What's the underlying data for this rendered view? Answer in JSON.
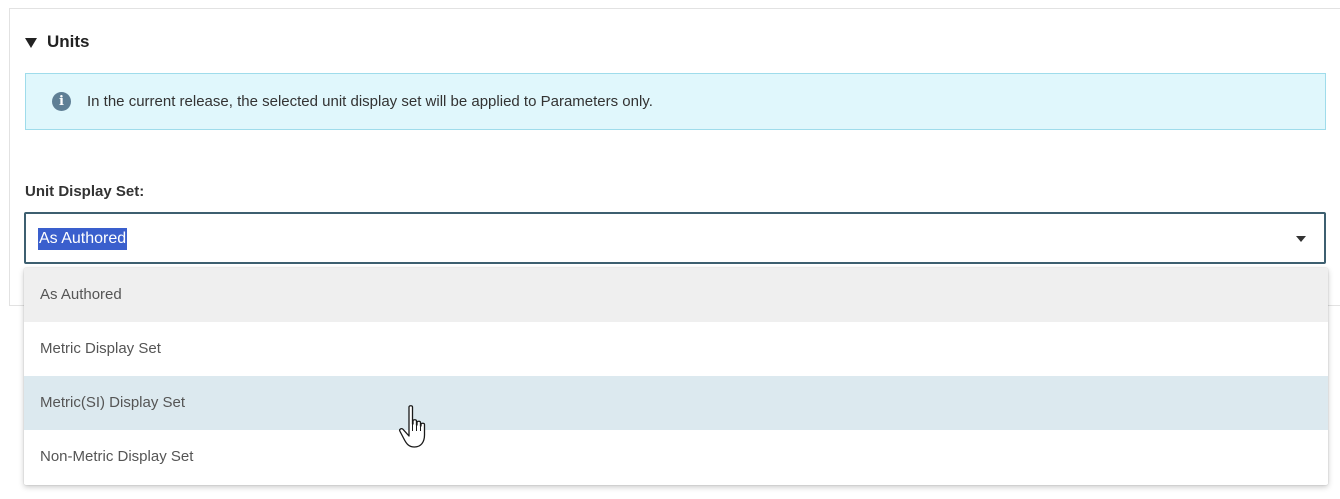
{
  "section": {
    "title": "Units",
    "expanded": true
  },
  "info_banner": {
    "icon": "info-icon",
    "icon_glyph": "i",
    "text": "In the current release, the selected unit display set will be applied to Parameters only."
  },
  "unit_display_set": {
    "label": "Unit Display Set:",
    "selected_value": "As Authored",
    "options": [
      "As Authored",
      "Metric Display Set",
      "Metric(SI) Display Set",
      "Non-Metric Display Set"
    ],
    "selected_index": 0,
    "hovered_index": 2
  },
  "colors": {
    "banner_bg": "#e0f7fc",
    "banner_border": "#9fdceb",
    "select_border": "#3d5f70",
    "text_highlight": "#3a5fcd",
    "selected_option_bg": "#efefef",
    "hovered_option_bg": "#dce9ef"
  }
}
